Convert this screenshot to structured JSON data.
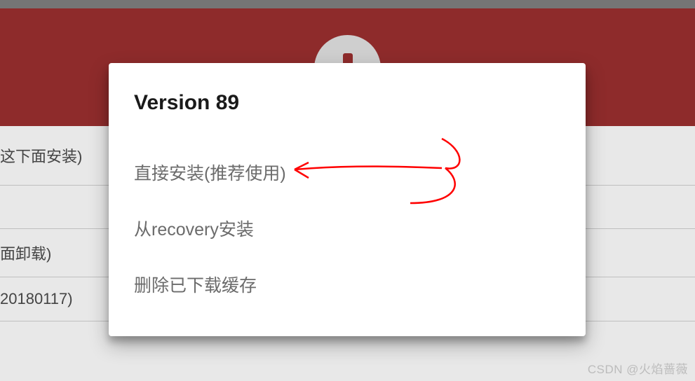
{
  "dialog": {
    "title": "Version 89",
    "options": [
      {
        "label": "直接安装(推荐使用)"
      },
      {
        "label": "从recovery安装"
      },
      {
        "label": "删除已下载缓存"
      }
    ]
  },
  "background_rows": [
    {
      "text": "这下面安装)"
    },
    {
      "text": "面卸载)"
    },
    {
      "text": "20180117)"
    }
  ],
  "watermark": "CSDN @火焰蔷薇",
  "colors": {
    "header": "#8e2b2b",
    "annotation": "#ff0000"
  }
}
